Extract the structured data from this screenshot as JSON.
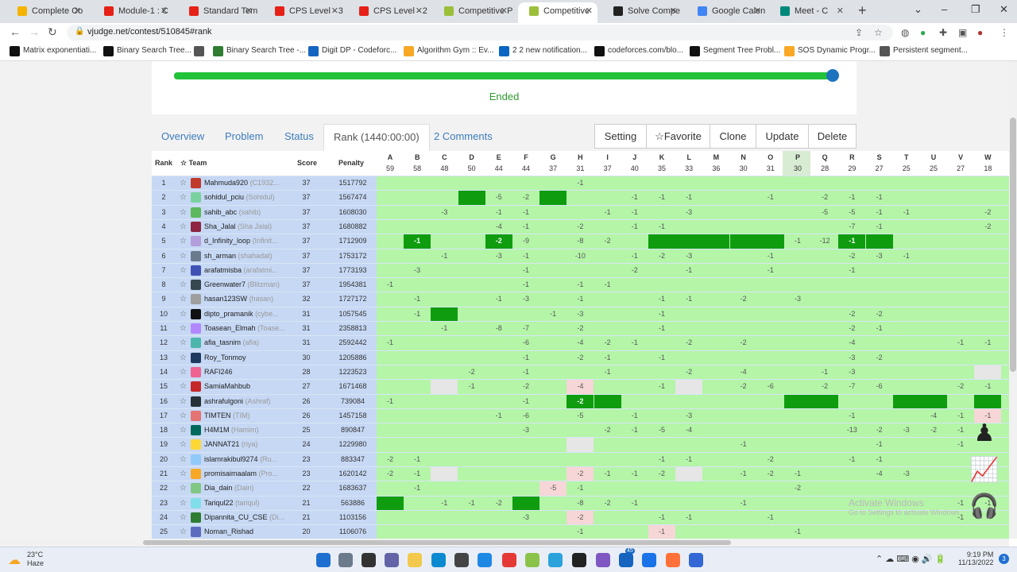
{
  "browser": {
    "tabs": [
      {
        "title": "Complete Co",
        "color": "#f4b400"
      },
      {
        "title": "Module-1 : C",
        "color": "#e62117"
      },
      {
        "title": "Standard Tem",
        "color": "#e62117"
      },
      {
        "title": "CPS Level - 3",
        "color": "#e62117"
      },
      {
        "title": "CPS Level - 2",
        "color": "#e62117"
      },
      {
        "title": "Competitive P",
        "color": "#9bbf3a"
      },
      {
        "title": "Competitive",
        "color": "#9bbf3a"
      },
      {
        "title": "Solve Compe",
        "color": "#222222"
      },
      {
        "title": "Google Calen",
        "color": "#4285f4"
      },
      {
        "title": "Meet - C",
        "color": "#00897b"
      }
    ],
    "url": "vjudge.net/contest/510845#rank",
    "bookmarks": [
      "Matrix exponentiati...",
      "Binary Search Tree...",
      "",
      "Binary Search Tree -...",
      "Digit DP - Codeforc...",
      "Algorithm Gym :: Ev...",
      "2 2 new notification...",
      "codeforces.com/blo...",
      "Segment Tree Probl...",
      "SOS Dynamic Progr...",
      "Persistent segment..."
    ]
  },
  "contest": {
    "status": "Ended",
    "progress": 100,
    "tabs": [
      "Overview",
      "Problem",
      "Status",
      "Rank (1440:00:00)",
      "2 Comments"
    ],
    "actions": [
      "Setting",
      "☆Favorite",
      "Clone",
      "Update",
      "Delete"
    ]
  },
  "table": {
    "headers": {
      "rank": "Rank",
      "team": "☆ Team",
      "score": "Score",
      "penalty": "Penalty"
    },
    "problems": [
      {
        "id": "A",
        "solved": "59"
      },
      {
        "id": "B",
        "solved": "58"
      },
      {
        "id": "C",
        "solved": "48"
      },
      {
        "id": "D",
        "solved": "50"
      },
      {
        "id": "E",
        "solved": "44"
      },
      {
        "id": "F",
        "solved": "44"
      },
      {
        "id": "G",
        "solved": "37"
      },
      {
        "id": "H",
        "solved": "31"
      },
      {
        "id": "I",
        "solved": "37"
      },
      {
        "id": "J",
        "solved": "40"
      },
      {
        "id": "K",
        "solved": "35"
      },
      {
        "id": "L",
        "solved": "33"
      },
      {
        "id": "M",
        "solved": "36"
      },
      {
        "id": "N",
        "solved": "30"
      },
      {
        "id": "O",
        "solved": "31"
      },
      {
        "id": "P",
        "solved": "30"
      },
      {
        "id": "Q",
        "solved": "28"
      },
      {
        "id": "R",
        "solved": "29"
      },
      {
        "id": "S",
        "solved": "27"
      },
      {
        "id": "T",
        "solved": "25"
      },
      {
        "id": "U",
        "solved": "25"
      },
      {
        "id": "V",
        "solved": "27"
      },
      {
        "id": "W",
        "solved": "18"
      }
    ],
    "rows": [
      {
        "rank": "1",
        "team": "Mahmuda920",
        "nick": "(C1932...",
        "score": "37",
        "penalty": "1517792",
        "avatar": "#c0392b",
        "cells": {
          "H": "-1"
        }
      },
      {
        "rank": "2",
        "team": "sohidul_pciu",
        "nick": "(Sohidul)",
        "score": "37",
        "penalty": "1567474",
        "avatar": "#7ad1a0",
        "cells": {
          "D": "fb",
          "E": "-5",
          "F": "-2",
          "G": "fb",
          "J": "-1",
          "K": "-1",
          "L": "-1",
          "O": "-1",
          "Q": "-2",
          "R": "-1",
          "S": "-1"
        }
      },
      {
        "rank": "3",
        "team": "sahib_abc",
        "nick": "(sahib)",
        "score": "37",
        "penalty": "1608030",
        "avatar": "#5cb85c",
        "cells": {
          "C": "-3",
          "E": "-1",
          "F": "-1",
          "I": "-1",
          "J": "-1",
          "L": "-3",
          "Q": "-5",
          "R": "-5",
          "S": "-1",
          "T": "-1",
          "W": "-2"
        }
      },
      {
        "rank": "4",
        "team": "Sha_Jalal",
        "nick": "(Sha Jalal)",
        "score": "37",
        "penalty": "1680882",
        "avatar": "#8e2442",
        "cells": {
          "E": "-4",
          "F": "-1",
          "H": "-2",
          "J": "-1",
          "K": "-1",
          "R": "-7",
          "S": "-1",
          "W": "-2"
        }
      },
      {
        "rank": "5",
        "team": "d_Infinity_loop",
        "nick": "(Infinit...",
        "score": "37",
        "penalty": "1712909",
        "avatar": "#b39ddb",
        "cells": {
          "B": "fb-1",
          "E": "fb-2",
          "F": "-9",
          "H": "-8",
          "I": "-2",
          "K": "fb",
          "L": "fb",
          "M": "fb",
          "N": "fb",
          "O": "fb",
          "P": "-1",
          "Q": "-12",
          "R": "fb-1",
          "S": "fb"
        }
      },
      {
        "rank": "6",
        "team": "sh_arman",
        "nick": "(shahadat)",
        "score": "37",
        "penalty": "1753172",
        "avatar": "#6b7b8c",
        "cells": {
          "C": "-1",
          "E": "-3",
          "F": "-1",
          "H": "-10",
          "J": "-1",
          "K": "-2",
          "L": "-3",
          "O": "-1",
          "R": "-2",
          "S": "-3",
          "T": "-1"
        }
      },
      {
        "rank": "7",
        "team": "arafatmisba",
        "nick": "(arafatmi...",
        "score": "37",
        "penalty": "1773193",
        "avatar": "#3f51b5",
        "cells": {
          "B": "-3",
          "F": "-1",
          "J": "-2",
          "L": "-1",
          "O": "-1",
          "R": "-1"
        }
      },
      {
        "rank": "8",
        "team": "Greenwater7",
        "nick": "(Blitzman)",
        "score": "37",
        "penalty": "1954381",
        "avatar": "#37474f",
        "cells": {
          "A": "-1",
          "F": "-1",
          "H": "-1",
          "I": "-1"
        }
      },
      {
        "rank": "9",
        "team": "hasan123SW",
        "nick": "(hasan)",
        "score": "32",
        "penalty": "1727172",
        "avatar": "#9e9e9e",
        "cells": {
          "B": "-1",
          "E": "-1",
          "F": "-3",
          "H": "-1",
          "K": "-1",
          "L": "-1",
          "N": "-2",
          "P": "-3"
        }
      },
      {
        "rank": "10",
        "team": "dipto_pramanik",
        "nick": "(cybe...",
        "score": "31",
        "penalty": "1057545",
        "avatar": "#111111",
        "cells": {
          "B": "-1",
          "C": "fb",
          "G": "-1",
          "H": "-3",
          "K": "-1",
          "R": "-2",
          "S": "-2"
        }
      },
      {
        "rank": "11",
        "team": "Toasean_Elmah",
        "nick": "(Toase...",
        "score": "31",
        "penalty": "2358813",
        "avatar": "#b388ff",
        "cells": {
          "C": "-1",
          "E": "-8",
          "F": "-7",
          "H": "-2",
          "K": "-1",
          "R": "-2",
          "S": "-1"
        }
      },
      {
        "rank": "12",
        "team": "afia_tasnim",
        "nick": "(afia)",
        "score": "31",
        "penalty": "2592442",
        "avatar": "#4db6ac",
        "cells": {
          "A": "-1",
          "F": "-6",
          "H": "-4",
          "I": "-2",
          "J": "-1",
          "L": "-2",
          "N": "-2",
          "R": "-4",
          "V": "-1",
          "W": "-1"
        }
      },
      {
        "rank": "13",
        "team": "Roy_Tonmoy",
        "nick": "",
        "score": "30",
        "penalty": "1205886",
        "avatar": "#1e3a5f",
        "cells": {
          "F": "-1",
          "H": "-2",
          "I": "-1",
          "K": "-1",
          "R": "-3",
          "S": "-2"
        }
      },
      {
        "rank": "14",
        "team": "RAFI246",
        "nick": "",
        "score": "28",
        "penalty": "1223523",
        "avatar": "#f06292",
        "cells": {
          "D": "-2",
          "F": "-1",
          "I": "-1",
          "L": "-2",
          "N": "-4",
          "Q": "-1",
          "R": "-3",
          "W": "gy"
        }
      },
      {
        "rank": "15",
        "team": "SamiaMahbub",
        "nick": "",
        "score": "27",
        "penalty": "1671468",
        "avatar": "#c62828",
        "cells": {
          "C": "gy",
          "D": "-1",
          "F": "-2",
          "H": "re-4",
          "K": "-1",
          "L": "gy",
          "N": "-2",
          "O": "-6",
          "Q": "-2",
          "R": "-7",
          "S": "-6",
          "V": "-2",
          "W": "-1"
        }
      },
      {
        "rank": "16",
        "team": "ashrafulgoni",
        "nick": "(Ashraf)",
        "score": "26",
        "penalty": "739084",
        "avatar": "#263238",
        "cells": {
          "A": "-1",
          "F": "-1",
          "H": "fb-2",
          "I": "fb",
          "P": "fb",
          "Q": "fb",
          "T": "fb",
          "U": "fb",
          "W": "fb"
        }
      },
      {
        "rank": "17",
        "team": "TIMTEN",
        "nick": "(TIM)",
        "score": "26",
        "penalty": "1457158",
        "avatar": "#e57373",
        "cells": {
          "E": "-1",
          "F": "-6",
          "H": "-5",
          "J": "-1",
          "L": "-3",
          "R": "-1",
          "U": "-4",
          "V": "-1",
          "W": "re-1"
        }
      },
      {
        "rank": "18",
        "team": "H4M1M",
        "nick": "(Hamim)",
        "score": "25",
        "penalty": "890847",
        "avatar": "#00695c",
        "cells": {
          "F": "-3",
          "I": "-2",
          "J": "-1",
          "K": "-5",
          "L": "-4",
          "R": "-13",
          "S": "-2",
          "T": "-3",
          "U": "-2",
          "V": "-1"
        }
      },
      {
        "rank": "19",
        "team": "JANNAT21",
        "nick": "(riya)",
        "score": "24",
        "penalty": "1229980",
        "avatar": "#fdd835",
        "cells": {
          "H": "gy",
          "N": "-1",
          "S": "-1",
          "V": "-1"
        }
      },
      {
        "rank": "20",
        "team": "islamrakibul9274",
        "nick": "(Ru...",
        "score": "23",
        "penalty": "883347",
        "avatar": "#90caf9",
        "cells": {
          "A": "-2",
          "B": "-1",
          "K": "-1",
          "L": "-1",
          "O": "-2",
          "R": "-1",
          "S": "-1"
        }
      },
      {
        "rank": "21",
        "team": "promisaimaalam",
        "nick": "(Pro...",
        "score": "23",
        "penalty": "1620142",
        "avatar": "#f9a825",
        "cells": {
          "A": "-2",
          "B": "-1",
          "C": "gy",
          "H": "re-2",
          "I": "-1",
          "J": "-1",
          "K": "-2",
          "L": "gy",
          "N": "-1",
          "O": "-2",
          "P": "-1",
          "S": "-4",
          "T": "-3"
        }
      },
      {
        "rank": "22",
        "team": "Dia_dain",
        "nick": "(Dain)",
        "score": "22",
        "penalty": "1683637",
        "avatar": "#81c784",
        "cells": {
          "B": "-1",
          "G": "re-5",
          "H": "-1",
          "P": "-2"
        }
      },
      {
        "rank": "23",
        "team": "Tariqul22",
        "nick": "(tariqul)",
        "score": "21",
        "penalty": "563886",
        "avatar": "#80deea",
        "cells": {
          "A": "fb",
          "C": "-1",
          "D": "-1",
          "E": "-2",
          "F": "fb",
          "H": "-8",
          "I": "-2",
          "J": "-1",
          "N": "-1",
          "V": "-1",
          "W": "-1"
        }
      },
      {
        "rank": "24",
        "team": "Dipannita_CU_CSE",
        "nick": "(Di...",
        "score": "21",
        "penalty": "1103156",
        "avatar": "#2e7d32",
        "cells": {
          "F": "-3",
          "H": "re-2",
          "K": "-1",
          "L": "-1",
          "O": "-1",
          "V": "-1"
        }
      },
      {
        "rank": "25",
        "team": "Noman_Rishad",
        "nick": "",
        "score": "20",
        "penalty": "1106076",
        "avatar": "#5c6bc0",
        "cells": {
          "H": "-1",
          "K": "re-1",
          "P": "-1"
        }
      }
    ]
  },
  "overlay": {
    "watermark_title": "Activate Windows",
    "watermark_sub": "Go to Settings to activate Windows."
  },
  "taskbar": {
    "weather_temp": "23°C",
    "weather_desc": "Haze",
    "time": "9:19 PM",
    "date": "11/13/2022",
    "badge": "45",
    "notif_count": "3"
  }
}
